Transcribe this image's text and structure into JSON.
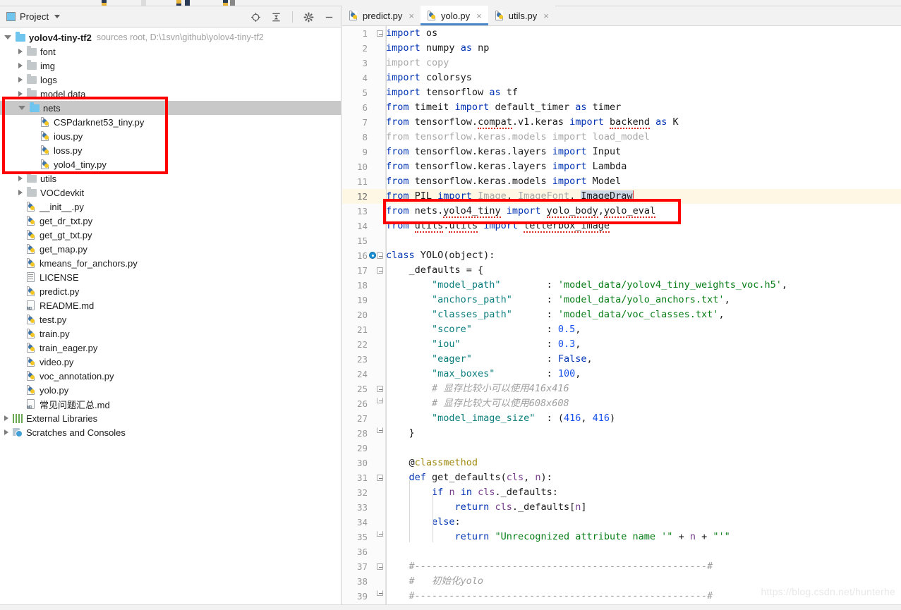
{
  "project_panel": {
    "title": "Project",
    "icons": [
      {
        "name": "locate-icon",
        "glyph": "target"
      },
      {
        "name": "collapse-all-icon",
        "glyph": "collapse"
      },
      {
        "name": "settings-gear-icon",
        "glyph": "gear"
      },
      {
        "name": "minimize-icon",
        "glyph": "minus"
      }
    ],
    "tree": [
      {
        "label": "yolov4-tiny-tf2",
        "meta": "sources root,  D:\\1svn\\github\\yolov4-tiny-tf2",
        "type": "folder-blue",
        "indent": 0,
        "state": "open",
        "bold": true
      },
      {
        "label": "font",
        "type": "folder",
        "indent": 1,
        "state": "closed"
      },
      {
        "label": "img",
        "type": "folder",
        "indent": 1,
        "state": "closed"
      },
      {
        "label": "logs",
        "type": "folder",
        "indent": 1,
        "state": "closed"
      },
      {
        "label": "model data",
        "type": "folder",
        "indent": 1,
        "state": "closed"
      },
      {
        "label": "nets",
        "type": "folder-blue",
        "indent": 1,
        "state": "open",
        "selected": true
      },
      {
        "label": "CSPdarknet53_tiny.py",
        "type": "py",
        "indent": 2
      },
      {
        "label": "ious.py",
        "type": "py",
        "indent": 2
      },
      {
        "label": "loss.py",
        "type": "py",
        "indent": 2
      },
      {
        "label": "yolo4_tiny.py",
        "type": "py",
        "indent": 2
      },
      {
        "label": "utils",
        "type": "folder",
        "indent": 1,
        "state": "closed"
      },
      {
        "label": "VOCdevkit",
        "type": "folder",
        "indent": 1,
        "state": "closed"
      },
      {
        "label": "__init__.py",
        "type": "py",
        "indent": 1
      },
      {
        "label": "get_dr_txt.py",
        "type": "py",
        "indent": 1
      },
      {
        "label": "get_gt_txt.py",
        "type": "py",
        "indent": 1
      },
      {
        "label": "get_map.py",
        "type": "py",
        "indent": 1
      },
      {
        "label": "kmeans_for_anchors.py",
        "type": "py",
        "indent": 1
      },
      {
        "label": "LICENSE",
        "type": "license",
        "indent": 1
      },
      {
        "label": "predict.py",
        "type": "py",
        "indent": 1
      },
      {
        "label": "README.md",
        "type": "md",
        "indent": 1
      },
      {
        "label": "test.py",
        "type": "py",
        "indent": 1
      },
      {
        "label": "train.py",
        "type": "py",
        "indent": 1
      },
      {
        "label": "train_eager.py",
        "type": "py",
        "indent": 1
      },
      {
        "label": "video.py",
        "type": "py",
        "indent": 1
      },
      {
        "label": "voc_annotation.py",
        "type": "py",
        "indent": 1
      },
      {
        "label": "yolo.py",
        "type": "py",
        "indent": 1
      },
      {
        "label": "常见问题汇总.md",
        "type": "md",
        "indent": 1
      },
      {
        "label": "External Libraries",
        "type": "lib",
        "indent": 0,
        "state": "closed"
      },
      {
        "label": "Scratches and Consoles",
        "type": "scratch",
        "indent": 0,
        "state": "closed"
      }
    ]
  },
  "editor": {
    "tabs": [
      {
        "label": "predict.py",
        "active": false
      },
      {
        "label": "yolo.py",
        "active": true
      },
      {
        "label": "utils.py",
        "active": false
      }
    ],
    "close_glyph": "×",
    "lines": [
      {
        "n": 1,
        "text": "import os"
      },
      {
        "n": 2,
        "text": "import numpy as np"
      },
      {
        "n": 3,
        "text": "import copy"
      },
      {
        "n": 4,
        "text": "import colorsys"
      },
      {
        "n": 5,
        "text": "import tensorflow as tf"
      },
      {
        "n": 6,
        "text": "from timeit import default_timer as timer"
      },
      {
        "n": 7,
        "text": "from tensorflow.compat.v1.keras import backend as K"
      },
      {
        "n": 8,
        "text": "from tensorflow.keras.models import load_model"
      },
      {
        "n": 9,
        "text": "from tensorflow.keras.layers import Input"
      },
      {
        "n": 10,
        "text": "from tensorflow.keras.layers import Lambda"
      },
      {
        "n": 11,
        "text": "from tensorflow.keras.models import Model"
      },
      {
        "n": 12,
        "text": "from PIL import Image, ImageFont, ImageDraw"
      },
      {
        "n": 13,
        "text": "from nets.yolo4_tiny import yolo_body,yolo_eval"
      },
      {
        "n": 14,
        "text": "from utils.utils import letterbox_image"
      },
      {
        "n": 15,
        "text": ""
      },
      {
        "n": 16,
        "text": "class YOLO(object):"
      },
      {
        "n": 17,
        "text": "    _defaults = {"
      },
      {
        "n": 18,
        "text": "        \"model_path\"        : 'model_data/yolov4_tiny_weights_voc.h5',"
      },
      {
        "n": 19,
        "text": "        \"anchors_path\"      : 'model_data/yolo_anchors.txt',"
      },
      {
        "n": 20,
        "text": "        \"classes_path\"      : 'model_data/voc_classes.txt',"
      },
      {
        "n": 21,
        "text": "        \"score\"             : 0.5,"
      },
      {
        "n": 22,
        "text": "        \"iou\"               : 0.3,"
      },
      {
        "n": 23,
        "text": "        \"eager\"             : False,"
      },
      {
        "n": 24,
        "text": "        \"max_boxes\"         : 100,"
      },
      {
        "n": 25,
        "text": "        # 显存比较小可以使用416x416"
      },
      {
        "n": 26,
        "text": "        # 显存比较大可以使用608x608"
      },
      {
        "n": 27,
        "text": "        \"model_image_size\"  : (416, 416)"
      },
      {
        "n": 28,
        "text": "    }"
      },
      {
        "n": 29,
        "text": ""
      },
      {
        "n": 30,
        "text": "    @classmethod"
      },
      {
        "n": 31,
        "text": "    def get_defaults(cls, n):"
      },
      {
        "n": 32,
        "text": "        if n in cls._defaults:"
      },
      {
        "n": 33,
        "text": "            return cls._defaults[n]"
      },
      {
        "n": 34,
        "text": "        else:"
      },
      {
        "n": 35,
        "text": "            return \"Unrecognized attribute name '\" + n + \"'\""
      },
      {
        "n": 36,
        "text": ""
      },
      {
        "n": 37,
        "text": "    #---------------------------------------------------#"
      },
      {
        "n": 38,
        "text": "    #   初始化yolo"
      },
      {
        "n": 39,
        "text": "    #---------------------------------------------------#"
      }
    ]
  },
  "annotations": [
    {
      "name": "nets-folder-highlight",
      "color": "#ff0000"
    },
    {
      "name": "import-line-highlight",
      "color": "#ff0000"
    }
  ],
  "watermark": "https://blog.csdn.net/hunterhe"
}
